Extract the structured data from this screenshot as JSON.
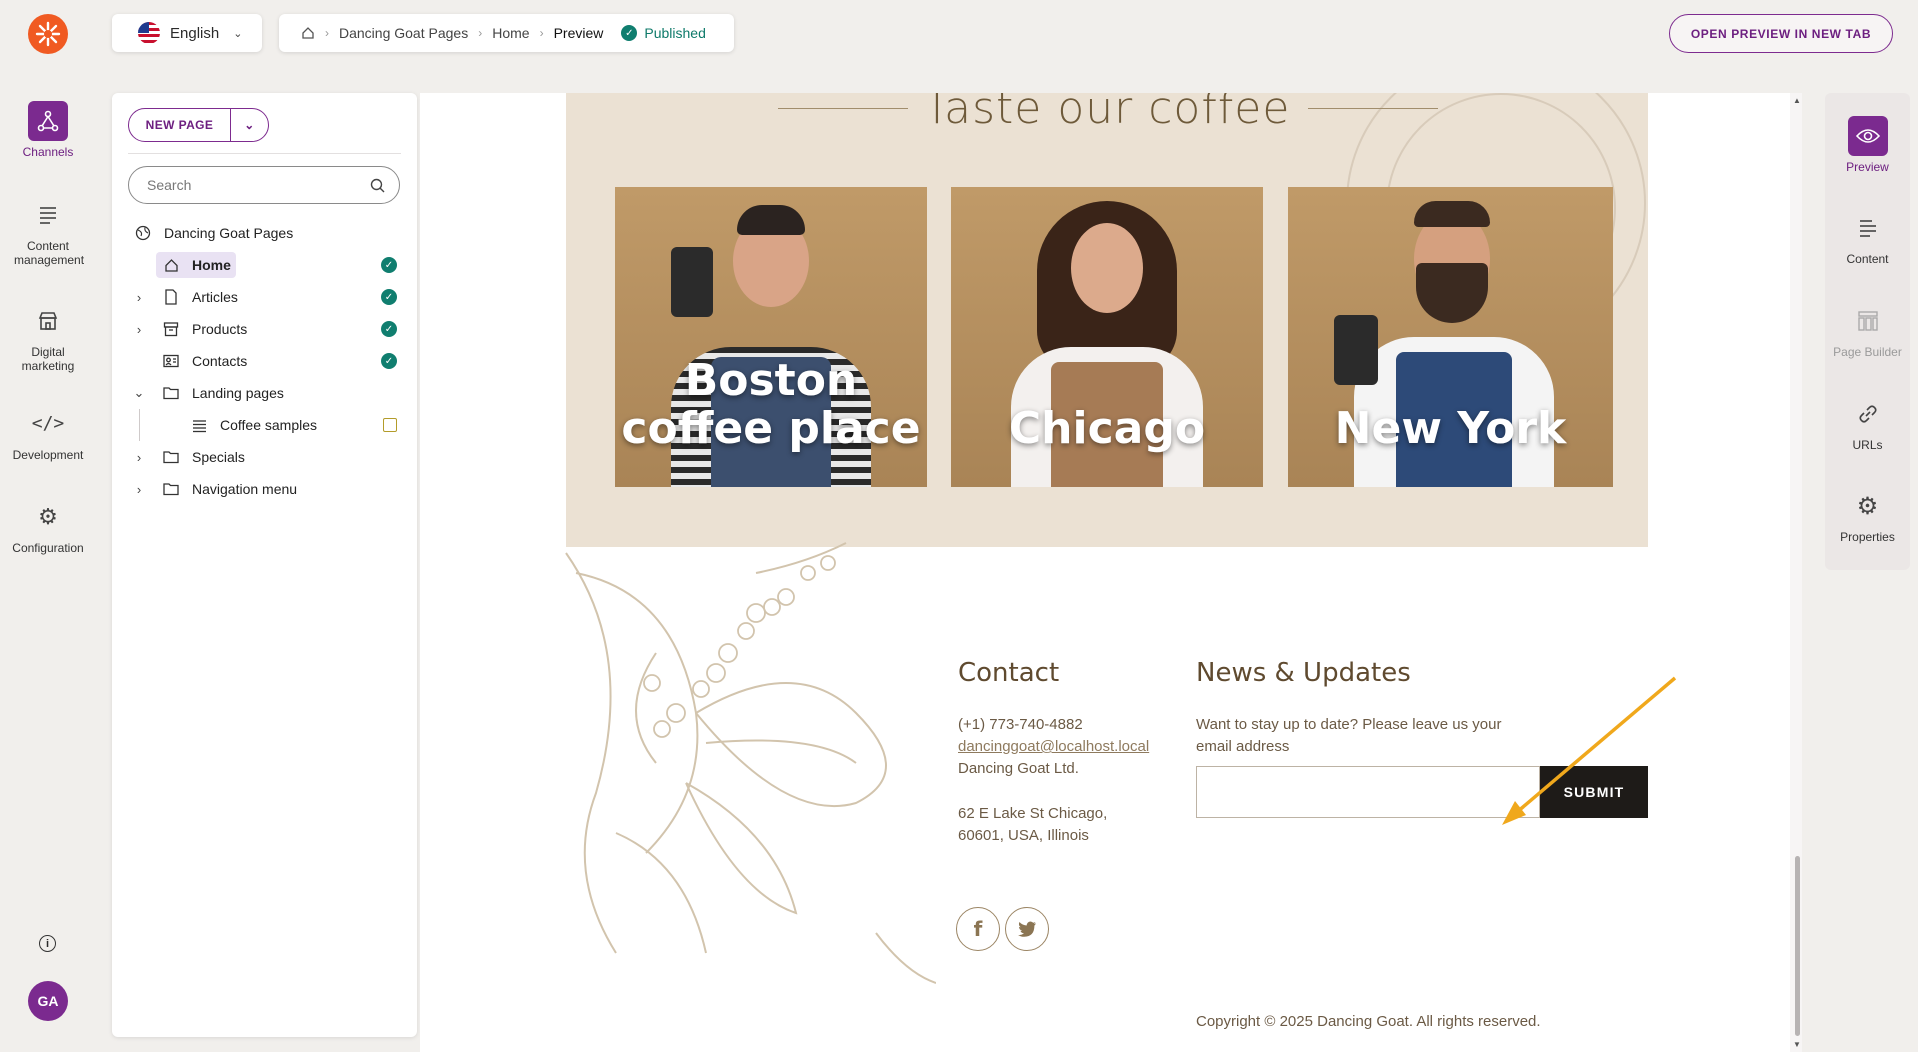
{
  "top": {
    "language": "English",
    "breadcrumb": [
      "Dancing Goat Pages",
      "Home",
      "Preview"
    ],
    "status": "Published",
    "open_preview_label": "OPEN PREVIEW IN NEW TAB"
  },
  "left_rail": {
    "items": [
      {
        "label": "Channels",
        "icon": "channels-icon",
        "active": true
      },
      {
        "label": "Content management",
        "icon": "content-management-icon"
      },
      {
        "label": "Digital marketing",
        "icon": "digital-marketing-icon"
      },
      {
        "label": "Development",
        "icon": "code-icon"
      },
      {
        "label": "Configuration",
        "icon": "gears-icon"
      }
    ],
    "avatar_initials": "GA"
  },
  "tree_panel": {
    "new_page_label": "NEW PAGE",
    "search_placeholder": "Search",
    "root": "Dancing Goat Pages",
    "nodes": [
      {
        "label": "Home",
        "icon": "home-icon",
        "status": "published",
        "selected": true
      },
      {
        "label": "Articles",
        "icon": "file-icon",
        "status": "published"
      },
      {
        "label": "Products",
        "icon": "box-icon",
        "status": "published"
      },
      {
        "label": "Contacts",
        "icon": "contacts-icon",
        "status": "published"
      },
      {
        "label": "Landing pages",
        "icon": "folder-icon",
        "expanded": true
      },
      {
        "label": "Coffee samples",
        "icon": "list-icon",
        "status": "draft"
      },
      {
        "label": "Specials",
        "icon": "folder-icon"
      },
      {
        "label": "Navigation menu",
        "icon": "folder-icon"
      }
    ]
  },
  "preview": {
    "section_title": "Taste our coffee",
    "cafes": [
      "Boston coffee place",
      "Chicago",
      "New York"
    ],
    "contact": {
      "heading": "Contact",
      "phone": "(+1) 773-740-4882",
      "email": "dancinggoat@localhost.local",
      "company": "Dancing Goat Ltd.",
      "address_line1": "62 E Lake St Chicago,",
      "address_line2": "60601, USA, Illinois"
    },
    "news": {
      "heading": "News & Updates",
      "text_line1": "Want to stay up to date? Please leave us your",
      "text_line2": "email address",
      "submit_label": "SUBMIT"
    },
    "social": {
      "facebook": "f",
      "twitter": "t"
    },
    "copyright": "Copyright © 2025 Dancing Goat. All rights reserved."
  },
  "right_rail": {
    "items": [
      {
        "label": "Preview",
        "icon": "eye-icon",
        "active": true
      },
      {
        "label": "Content",
        "icon": "content-lines-icon"
      },
      {
        "label": "Page Builder",
        "icon": "page-builder-icon",
        "disabled": true
      },
      {
        "label": "URLs",
        "icon": "link-icon"
      },
      {
        "label": "Properties",
        "icon": "gear-icon"
      }
    ]
  },
  "colors": {
    "accent": "#7b2a8f",
    "published": "#107e6f",
    "logo": "#f05a22"
  }
}
